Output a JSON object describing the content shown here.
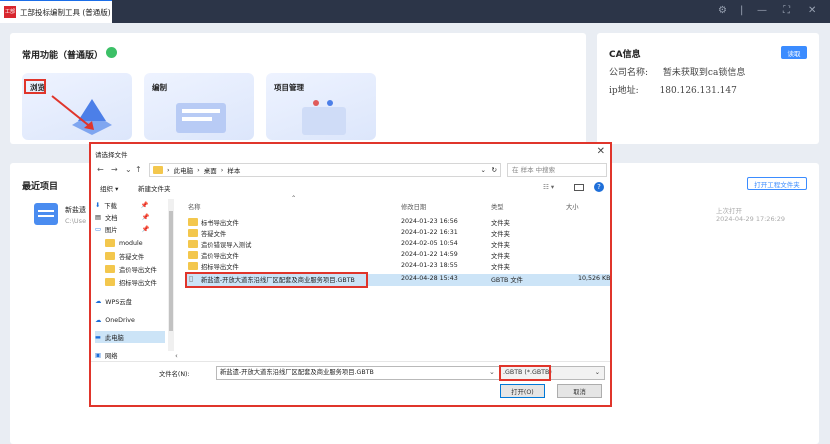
{
  "app": {
    "tab_title": "工部投标编制工具 (普通版)",
    "logo_text": "工部",
    "controls": {
      "settings": "⚙",
      "divider": "|",
      "minimize": "—",
      "maximize": "⛶",
      "close": "✕"
    }
  },
  "functions": {
    "title": "常用功能（普通版）",
    "cards": [
      {
        "label": "浏览"
      },
      {
        "label": "编制"
      },
      {
        "label": "项目管理"
      }
    ]
  },
  "ca": {
    "title": "CA信息",
    "read_button": "读取",
    "company_label": "公司名称:",
    "company_value": "暂未获取到ca锁信息",
    "ip_label": "ip地址:",
    "ip_value": "180.126.131.147"
  },
  "recent": {
    "title": "最近项目",
    "open_folder_button": "打开工程文件夹",
    "item_name": "新盐遗",
    "item_path": "C:\\Use",
    "last_open_label": "上次打开",
    "last_open_time": "2024-04-29 17:26:29"
  },
  "dialog": {
    "title": "请选择文件",
    "breadcrumb": [
      "此电脑",
      "桌面",
      "样本"
    ],
    "search_placeholder": "在 样本 中搜索",
    "organize": "组织 ▾",
    "new_folder": "新建文件夹",
    "sidebar": [
      {
        "label": "下载",
        "pin": true
      },
      {
        "label": "文档",
        "pin": true
      },
      {
        "label": "图片",
        "pin": true
      },
      {
        "label": "module",
        "pin": false
      },
      {
        "label": "答疑文件",
        "pin": false
      },
      {
        "label": "造价导出文件",
        "pin": false
      },
      {
        "label": "招标导出文件",
        "pin": false
      },
      {
        "label": "WPS云盘",
        "pin": false
      },
      {
        "label": "OneDrive",
        "pin": false
      },
      {
        "label": "此电脑",
        "pin": false
      },
      {
        "label": "网络",
        "pin": false
      }
    ],
    "columns": {
      "name": "名称",
      "date": "修改日期",
      "type": "类型",
      "size": "大小"
    },
    "rows": [
      {
        "name": "标书导出文件",
        "date": "2024-01-23 16:56",
        "type": "文件夹",
        "size": ""
      },
      {
        "name": "答疑文件",
        "date": "2024-01-22 16:31",
        "type": "文件夹",
        "size": ""
      },
      {
        "name": "造价错误导入测试",
        "date": "2024-02-05 10:54",
        "type": "文件夹",
        "size": ""
      },
      {
        "name": "造价导出文件",
        "date": "2024-01-22 14:59",
        "type": "文件夹",
        "size": ""
      },
      {
        "name": "招标导出文件",
        "date": "2024-01-23 18:55",
        "type": "文件夹",
        "size": ""
      },
      {
        "name": "新盐遗-开放大道东沿线厂区配套及商业服务项目.GBTB",
        "date": "2024-04-28 15:43",
        "type": "GBTB 文件",
        "size": "10,526 KB"
      }
    ],
    "filename_label": "文件名(N):",
    "filename_value": "新盐遗-开放大道东沿线厂区配套及商业服务项目.GBTB",
    "filter": ".GBTB (*.GBTB)",
    "open_button": "打开(O)",
    "cancel_button": "取消"
  }
}
